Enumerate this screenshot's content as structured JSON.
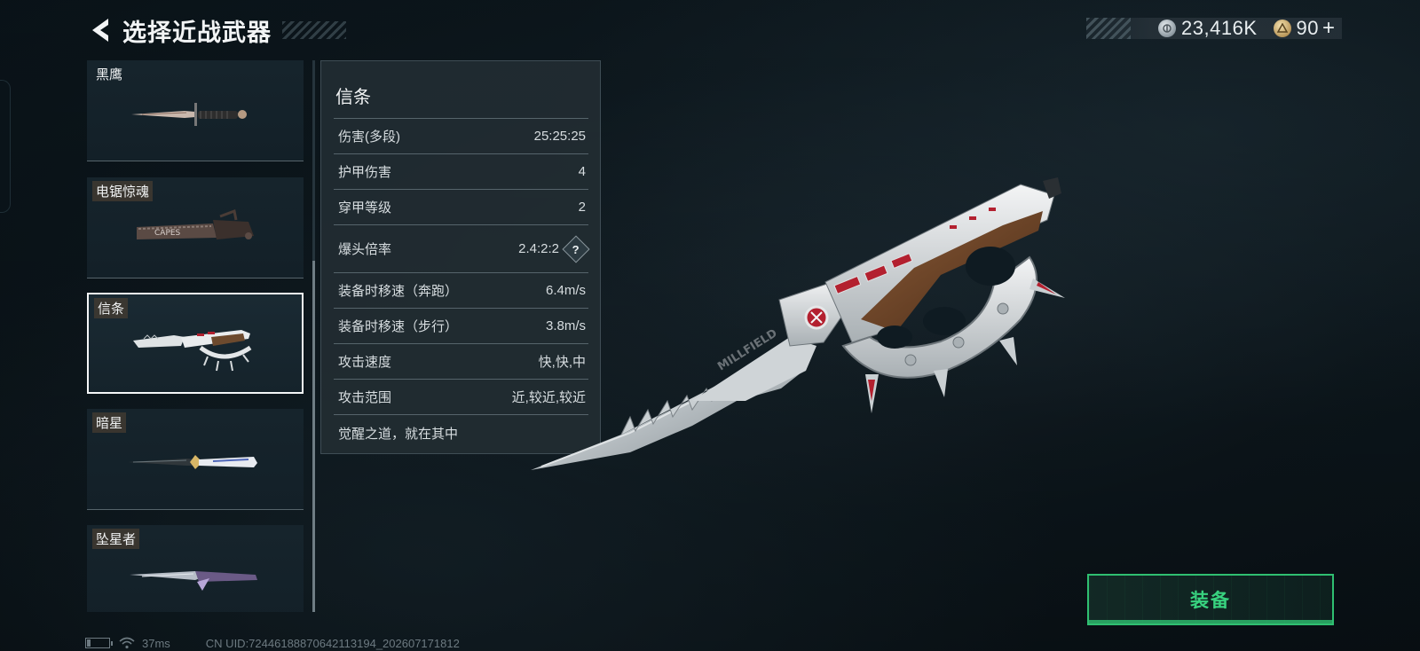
{
  "header": {
    "title": "选择近战武器",
    "back_icon": "chevron-left-icon"
  },
  "currency": [
    {
      "icon": "silver-coin-icon",
      "value": "23,416K"
    },
    {
      "icon": "gold-coin-icon",
      "value": "90"
    }
  ],
  "currency_plus": "+",
  "weapons": [
    {
      "name": "黑鹰",
      "selected": false
    },
    {
      "name": "电锯惊魂",
      "selected": false
    },
    {
      "name": "信条",
      "selected": true
    },
    {
      "name": "暗星",
      "selected": false
    },
    {
      "name": "坠星者",
      "selected": false
    }
  ],
  "stats": {
    "title": "信条",
    "rows": [
      {
        "label": "伤害(多段)",
        "value": "25:25:25"
      },
      {
        "label": "护甲伤害",
        "value": "4"
      },
      {
        "label": "穿甲等级",
        "value": "2"
      },
      {
        "label": "爆头倍率",
        "value": "2.4:2:2",
        "help": "?"
      },
      {
        "label": "装备时移速（奔跑）",
        "value": "6.4m/s"
      },
      {
        "label": "装备时移速（步行）",
        "value": "3.8m/s"
      },
      {
        "label": "攻击速度",
        "value": "快,快,中"
      },
      {
        "label": "攻击范围",
        "value": "近,较近,较近"
      }
    ],
    "description": "觉醒之道，就在其中"
  },
  "preview_text": "MILLFIELD",
  "equip_button": {
    "label": "装备"
  },
  "status_bar": {
    "ping": "37ms",
    "uid": "CN UID:7244618887064211319​4_202607171812"
  },
  "colors": {
    "accent_green": "#2fbf71",
    "background": "#0f1b22",
    "panel": "#222c32"
  }
}
